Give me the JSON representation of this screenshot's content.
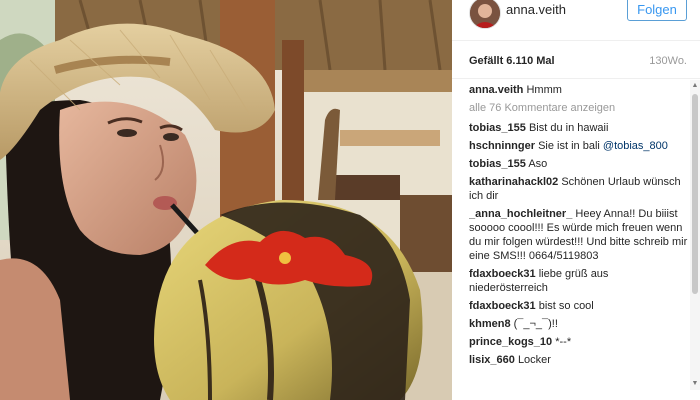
{
  "post": {
    "username": "anna.veith",
    "follow_label": "Folgen",
    "likes": "Gefällt 6.110 Mal",
    "time": "130Wo."
  },
  "caption": {
    "user": "anna.veith",
    "text": "Hmmm"
  },
  "show_all_comments": "alle 76 Kommentare anzeigen",
  "comments": [
    {
      "user": "tobias_155",
      "text": "Bist du in hawaii",
      "mention": ""
    },
    {
      "user": "hschninnger",
      "text": "Sie ist in bali",
      "mention": "@tobias_800"
    },
    {
      "user": "tobias_155",
      "text": "Aso",
      "mention": ""
    },
    {
      "user": "katharinahackl02",
      "text": "Schönen Urlaub wünsch ich dir",
      "mention": ""
    },
    {
      "user": "_anna_hochleitner_",
      "text": "Heey Anna!! Du biiist sooooo coool!!! Es würde mich freuen wenn du mir folgen würdest!!! Und bitte schreib mir eine SMS!!! 0664/5119803",
      "mention": ""
    },
    {
      "user": "fdaxboeck31",
      "text": "liebe grüß aus niederösterreich",
      "mention": ""
    },
    {
      "user": "fdaxboeck31",
      "text": "bist so cool",
      "mention": ""
    },
    {
      "user": "khmen8",
      "text": "(¯_¬_¯)!!",
      "mention": ""
    },
    {
      "user": "prince_kogs_10",
      "text": "*--*",
      "mention": ""
    },
    {
      "user": "lisix_660",
      "text": "Locker",
      "mention": ""
    }
  ],
  "colors": {
    "follow_blue": "#3897f0",
    "mention_blue": "#003569",
    "muted_gray": "#999999"
  }
}
